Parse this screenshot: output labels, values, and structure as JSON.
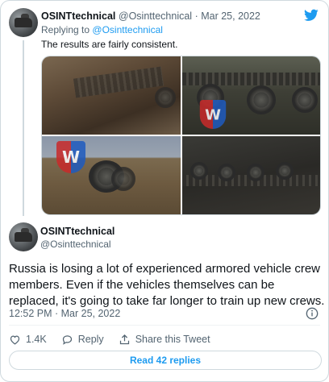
{
  "parent_tweet": {
    "display_name": "OSINTtechnical",
    "handle": "@Osinttechnical",
    "separator": "·",
    "date": "Mar 25, 2022",
    "replying_prefix": "Replying to",
    "replying_to": "@Osinttechnical",
    "text": "The results are fairly consistent."
  },
  "main_tweet": {
    "display_name": "OSINTtechnical",
    "handle": "@Osinttechnical",
    "text": "Russia is losing a lot of experienced armored vehicle crew members. Even if the vehicles themselves can be replaced, it's going to take far longer to train up new crews.",
    "time": "12:52 PM · Mar 25, 2022"
  },
  "actions": {
    "like_count": "1.4K",
    "reply_label": "Reply",
    "share_label": "Share this Tweet"
  },
  "read_replies_label": "Read 42 replies",
  "icons": {
    "brand": "twitter-bird-icon",
    "info": "info-icon",
    "like": "heart-icon",
    "reply": "speech-bubble-icon",
    "share": "share-arrow-icon"
  },
  "colors": {
    "accent": "#1d9bf0",
    "text": "#0f1419",
    "secondary": "#536471",
    "border": "#cfd9de"
  }
}
